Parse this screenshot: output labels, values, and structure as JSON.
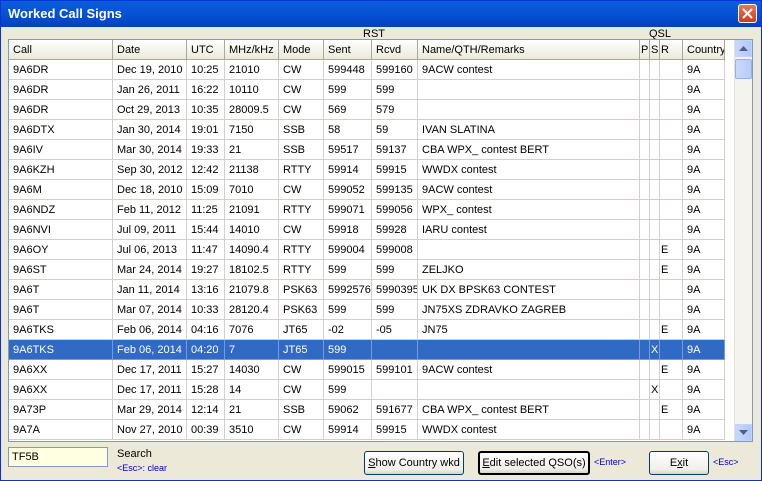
{
  "window": {
    "title": "Worked Call Signs"
  },
  "group_headers": {
    "rst": "RST",
    "qsl": "QSL"
  },
  "columns": [
    "Call",
    "Date",
    "UTC",
    "MHz/kHz",
    "Mode",
    "Sent",
    "Rcvd",
    "Name/QTH/Remarks",
    "P",
    "S",
    "R",
    "Country"
  ],
  "rows": [
    {
      "call": "9A6DR",
      "date": "Dec 19, 2010",
      "utc": "10:25",
      "freq": "21010",
      "mode": "CW",
      "sent": "599448",
      "rcvd": "599160",
      "remarks": "9ACW contest",
      "p": "",
      "s": "",
      "r": "",
      "country": "9A"
    },
    {
      "call": "9A6DR",
      "date": "Jan 26, 2011",
      "utc": "16:22",
      "freq": "10110",
      "mode": "CW",
      "sent": "599",
      "rcvd": "599",
      "remarks": "",
      "p": "",
      "s": "",
      "r": "",
      "country": "9A"
    },
    {
      "call": "9A6DR",
      "date": "Oct 29, 2013",
      "utc": "10:35",
      "freq": "28009.5",
      "mode": "CW",
      "sent": "569",
      "rcvd": "579",
      "remarks": "",
      "p": "",
      "s": "",
      "r": "",
      "country": "9A"
    },
    {
      "call": "9A6DTX",
      "date": "Jan 30, 2014",
      "utc": "19:01",
      "freq": "7150",
      "mode": "SSB",
      "sent": "58",
      "rcvd": "59",
      "remarks": "IVAN SLATINA",
      "p": "",
      "s": "",
      "r": "",
      "country": "9A"
    },
    {
      "call": "9A6IV",
      "date": "Mar 30, 2014",
      "utc": "19:33",
      "freq": "21",
      "mode": "SSB",
      "sent": "59517",
      "rcvd": "59137",
      "remarks": "CBA WPX_ contest                            BERT",
      "p": "",
      "s": "",
      "r": "",
      "country": "9A"
    },
    {
      "call": "9A6KZH",
      "date": "Sep 30, 2012",
      "utc": "12:42",
      "freq": "21138",
      "mode": "RTTY",
      "sent": "59914",
      "rcvd": "59915",
      "remarks": "WWDX contest",
      "p": "",
      "s": "",
      "r": "",
      "country": "9A"
    },
    {
      "call": "9A6M",
      "date": "Dec 18, 2010",
      "utc": "15:09",
      "freq": "7010",
      "mode": "CW",
      "sent": "599052",
      "rcvd": "599135",
      "remarks": "9ACW contest",
      "p": "",
      "s": "",
      "r": "",
      "country": "9A"
    },
    {
      "call": "9A6NDZ",
      "date": "Feb 11, 2012",
      "utc": "11:25",
      "freq": "21091",
      "mode": "RTTY",
      "sent": "599071",
      "rcvd": "599056",
      "remarks": "WPX_ contest",
      "p": "",
      "s": "",
      "r": "",
      "country": "9A"
    },
    {
      "call": "9A6NVI",
      "date": "Jul 09, 2011",
      "utc": "15:44",
      "freq": "14010",
      "mode": "CW",
      "sent": "59918",
      "rcvd": "59928",
      "remarks": "IARU contest",
      "p": "",
      "s": "",
      "r": "",
      "country": "9A"
    },
    {
      "call": "9A6OY",
      "date": "Jul 06, 2013",
      "utc": "11:47",
      "freq": "14090.4",
      "mode": "RTTY",
      "sent": "599004",
      "rcvd": "599008",
      "remarks": "",
      "p": "",
      "s": "",
      "r": "E",
      "country": "9A"
    },
    {
      "call": "9A6ST",
      "date": "Mar 24, 2014",
      "utc": "19:27",
      "freq": "18102.5",
      "mode": "RTTY",
      "sent": "599",
      "rcvd": "599",
      "remarks": "ZELJKO",
      "p": "",
      "s": "",
      "r": "E",
      "country": "9A"
    },
    {
      "call": "9A6T",
      "date": "Jan 11, 2014",
      "utc": "13:16",
      "freq": "21079.8",
      "mode": "PSK63",
      "sent": "5992576",
      "rcvd": "5990395",
      "remarks": "UK DX BPSK63 CONTEST",
      "p": "",
      "s": "",
      "r": "",
      "country": "9A"
    },
    {
      "call": "9A6T",
      "date": "Mar 07, 2014",
      "utc": "10:33",
      "freq": "28120.4",
      "mode": "PSK63",
      "sent": "599",
      "rcvd": "599",
      "remarks": "JN75XS ZDRAVKO ZAGREB",
      "p": "",
      "s": "",
      "r": "",
      "country": "9A"
    },
    {
      "call": "9A6TKS",
      "date": "Feb 06, 2014",
      "utc": "04:16",
      "freq": "7076",
      "mode": "JT65",
      "sent": "-02",
      "rcvd": "-05",
      "remarks": "JN75",
      "p": "",
      "s": "",
      "r": "E",
      "country": "9A"
    },
    {
      "call": "9A6TKS",
      "date": "Feb 06, 2014",
      "utc": "04:20",
      "freq": "7",
      "mode": "JT65",
      "sent": "599",
      "rcvd": "",
      "remarks": "",
      "p": "",
      "s": "X",
      "r": "",
      "country": "9A",
      "selected": true
    },
    {
      "call": "9A6XX",
      "date": "Dec 17, 2011",
      "utc": "15:27",
      "freq": "14030",
      "mode": "CW",
      "sent": "599015",
      "rcvd": "599101",
      "remarks": "9ACW contest",
      "p": "",
      "s": "",
      "r": "E",
      "country": "9A"
    },
    {
      "call": "9A6XX",
      "date": "Dec 17, 2011",
      "utc": "15:28",
      "freq": "14",
      "mode": "CW",
      "sent": "599",
      "rcvd": "",
      "remarks": "",
      "p": "",
      "s": "X",
      "r": "",
      "country": "9A"
    },
    {
      "call": "9A73P",
      "date": "Mar 29, 2014",
      "utc": "12:14",
      "freq": "21",
      "mode": "SSB",
      "sent": "59062",
      "rcvd": "591677",
      "remarks": "CBA WPX_ contest                            BERT",
      "p": "",
      "s": "",
      "r": "E",
      "country": "9A"
    },
    {
      "call": "9A7A",
      "date": "Nov 27, 2010",
      "utc": "00:39",
      "freq": "3510",
      "mode": "CW",
      "sent": "59914",
      "rcvd": "59915",
      "remarks": "WWDX contest",
      "p": "",
      "s": "",
      "r": "",
      "country": "9A"
    }
  ],
  "search": {
    "value": "TF5B",
    "label": "Search",
    "hint": "<Esc>: clear"
  },
  "buttons": {
    "show_country": "Show Country wkd",
    "edit_selected": "Edit selected QSO(s)",
    "edit_hint": "<Enter>",
    "exit": "Exit",
    "exit_hint": "<Esc>"
  },
  "colors": {
    "title_bar": "#0453d6",
    "selection": "#316ac5",
    "search_bg": "#ffffe1",
    "hint_text": "#0000cc"
  }
}
